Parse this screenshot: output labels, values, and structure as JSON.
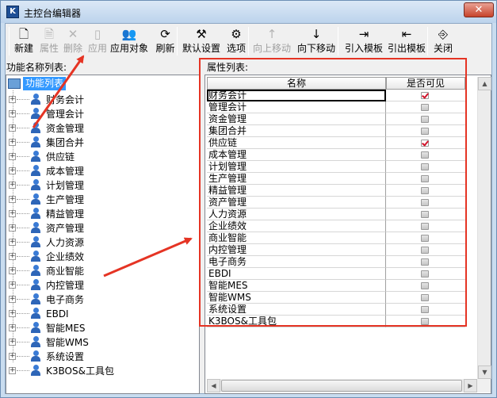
{
  "window": {
    "title": "主控台编辑器",
    "app_icon_letter": "K",
    "close_glyph": "✕"
  },
  "toolbar": {
    "buttons": [
      {
        "label": "新建",
        "icon": "new-document-icon",
        "glyph": "🗋",
        "enabled": true
      },
      {
        "label": "属性",
        "icon": "properties-icon",
        "glyph": "🗎",
        "enabled": false
      },
      {
        "label": "删除",
        "icon": "delete-icon",
        "glyph": "✕",
        "enabled": false
      },
      {
        "label": "应用",
        "icon": "apply-icon",
        "glyph": "▯",
        "enabled": false
      },
      {
        "label": "应用对象",
        "icon": "apply-objects-icon",
        "glyph": "👥",
        "enabled": true
      },
      {
        "label": "刷新",
        "icon": "refresh-icon",
        "glyph": "⟳",
        "enabled": true
      },
      {
        "label": "默认设置",
        "icon": "default-settings-icon",
        "glyph": "⚒",
        "enabled": true
      },
      {
        "label": "选项",
        "icon": "options-icon",
        "glyph": "⚙",
        "enabled": true
      },
      {
        "label": "向上移动",
        "icon": "move-up-icon",
        "glyph": "↑",
        "enabled": false
      },
      {
        "label": "向下移动",
        "icon": "move-down-icon",
        "glyph": "↓",
        "enabled": true
      },
      {
        "label": "引入模板",
        "icon": "import-template-icon",
        "glyph": "⇥",
        "enabled": true
      },
      {
        "label": "引出模板",
        "icon": "export-template-icon",
        "glyph": "⇤",
        "enabled": true
      },
      {
        "label": "关闭",
        "icon": "close-door-icon",
        "glyph": "⎆",
        "enabled": true
      }
    ]
  },
  "left_panel": {
    "header": "功能名称列表:",
    "root_label": "功能列表",
    "items": [
      "财务会计",
      "管理会计",
      "资金管理",
      "集团合并",
      "供应链",
      "成本管理",
      "计划管理",
      "生产管理",
      "精益管理",
      "资产管理",
      "人力资源",
      "企业绩效",
      "商业智能",
      "内控管理",
      "电子商务",
      "EBDI",
      "智能MES",
      "智能WMS",
      "系统设置",
      "K3BOS&工具包"
    ]
  },
  "right_panel": {
    "header": "属性列表:",
    "columns": {
      "name": "名称",
      "visible": "是否可见"
    },
    "rows": [
      {
        "name": "财务会计",
        "visible": true
      },
      {
        "name": "管理会计",
        "visible": false
      },
      {
        "name": "资金管理",
        "visible": false
      },
      {
        "name": "集团合并",
        "visible": false
      },
      {
        "name": "供应链",
        "visible": true
      },
      {
        "name": "成本管理",
        "visible": false
      },
      {
        "name": "计划管理",
        "visible": false
      },
      {
        "name": "生产管理",
        "visible": false
      },
      {
        "name": "精益管理",
        "visible": false
      },
      {
        "name": "资产管理",
        "visible": false
      },
      {
        "name": "人力资源",
        "visible": false
      },
      {
        "name": "企业绩效",
        "visible": false
      },
      {
        "name": "商业智能",
        "visible": false
      },
      {
        "name": "内控管理",
        "visible": false
      },
      {
        "name": "电子商务",
        "visible": false
      },
      {
        "name": "EBDI",
        "visible": false
      },
      {
        "name": "智能MES",
        "visible": false
      },
      {
        "name": "智能WMS",
        "visible": false
      },
      {
        "name": "系统设置",
        "visible": false
      },
      {
        "name": "K3BOS&工具包",
        "visible": false
      }
    ]
  },
  "colors": {
    "annotation_red": "#e53424",
    "selection_blue": "#3399ff",
    "check_red": "#d0132a"
  }
}
